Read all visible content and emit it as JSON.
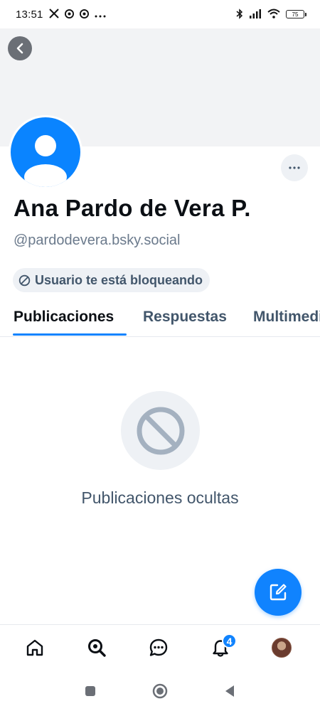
{
  "status_bar": {
    "time": "13:51",
    "left_icons": [
      "x-logo-icon",
      "chrome-icon",
      "chrome-icon",
      "more-dots-icon"
    ],
    "right_icons": [
      "bluetooth-icon",
      "signal-icon",
      "wifi-icon",
      "battery-icon"
    ],
    "battery_level": "75"
  },
  "profile": {
    "display_name": "Ana Pardo de Vera P.",
    "handle": "@pardodevera.bsky.social",
    "blocked_label": "Usuario te está bloqueando"
  },
  "tabs": [
    {
      "label": "Publicaciones",
      "active": true
    },
    {
      "label": "Respuestas",
      "active": false
    },
    {
      "label": "Multimedia",
      "active": false
    }
  ],
  "empty_state": {
    "label": "Publicaciones ocultas",
    "icon": "ban-icon"
  },
  "bottom_nav": {
    "items": [
      "home-icon",
      "search-icon",
      "chat-icon",
      "bell-icon",
      "profile-avatar"
    ],
    "notifications_badge": "4"
  },
  "system_nav": [
    "recents-icon",
    "home-circle-icon",
    "back-triangle-icon"
  ],
  "colors": {
    "accent": "#1083fe",
    "avatar_blue": "#0a84ff",
    "muted_text": "#42566b",
    "handle_text": "#6b7a8c",
    "banner": "#f2f3f5",
    "pill_bg": "#eef1f5"
  }
}
